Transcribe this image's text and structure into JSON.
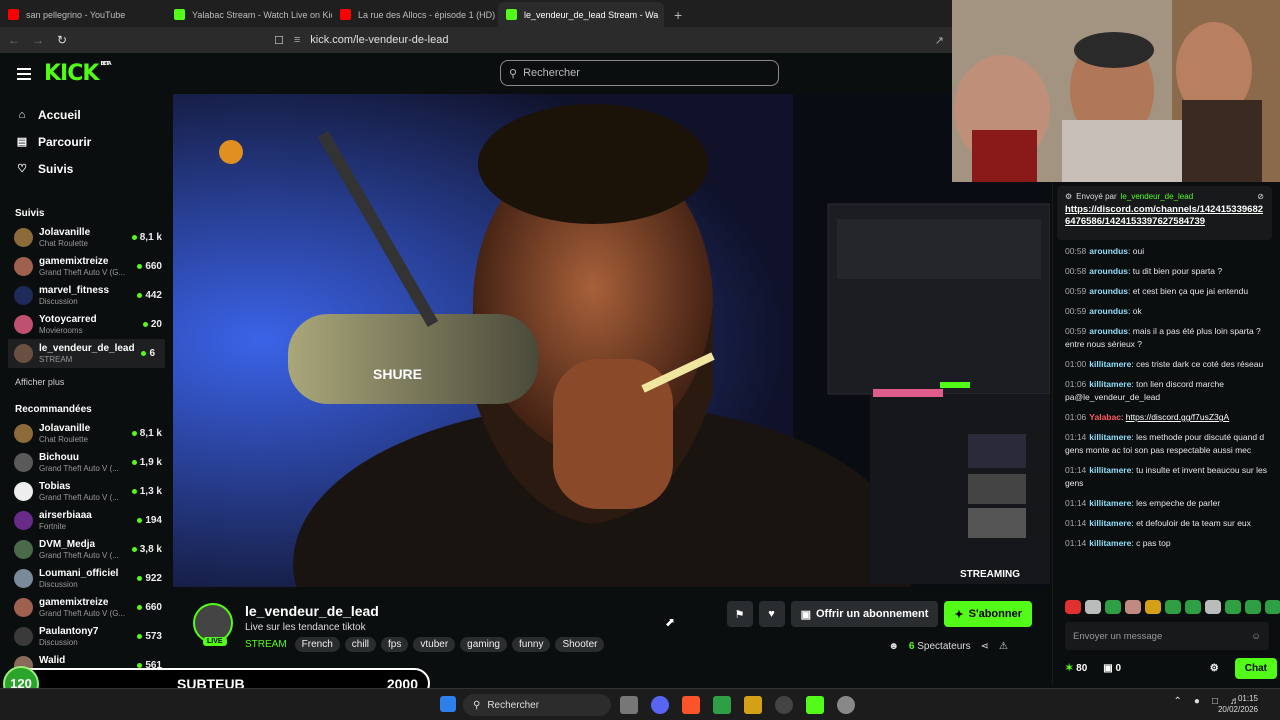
{
  "browser": {
    "tabs": [
      {
        "title": "san pellegrino - YouTube",
        "icon": "youtube-favicon",
        "color": "#ff0000",
        "active": false
      },
      {
        "title": "Yalabac Stream - Watch Live on Kick",
        "icon": "kick-favicon",
        "color": "#53fc18",
        "active": false
      },
      {
        "title": "La rue des Allocs - épisode 1 (HD) - Y",
        "icon": "youtube-favicon",
        "color": "#ff0000",
        "active": false
      },
      {
        "title": "le_vendeur_de_lead Stream - Wa",
        "icon": "kick-favicon",
        "color": "#53fc18",
        "active": true
      }
    ],
    "url": "kick.com/le-vendeur-de-lead"
  },
  "header": {
    "logo": "KICK",
    "beta": "BETA",
    "search_placeholder": "Rechercher"
  },
  "sidebar": {
    "nav": [
      {
        "label": "Accueil",
        "icon": "home-icon"
      },
      {
        "label": "Parcourir",
        "icon": "browse-icon"
      },
      {
        "label": "Suivis",
        "icon": "heart-icon"
      }
    ],
    "following_title": "Suivis",
    "following": [
      {
        "name": "Jolavanille",
        "category": "Chat Roulette",
        "viewers": "8,1 k",
        "color": "#8c6a3a"
      },
      {
        "name": "gamemixtreize",
        "category": "Grand Theft Auto V (G...",
        "viewers": "660",
        "color": "#a06050"
      },
      {
        "name": "marvel_fitness",
        "category": "Discussion",
        "viewers": "442",
        "color": "#1e2a5a"
      },
      {
        "name": "Yotoycarred",
        "category": "Movierooms",
        "viewers": "20",
        "color": "#c05070"
      },
      {
        "name": "le_vendeur_de_lead",
        "category": "STREAM",
        "viewers": "6",
        "color": "#6a5040",
        "active": true
      }
    ],
    "show_more": "Afficher plus",
    "recommended_title": "Recommandées",
    "recommended": [
      {
        "name": "Jolavanille",
        "category": "Chat Roulette",
        "viewers": "8,1 k",
        "color": "#8c6a3a"
      },
      {
        "name": "Bichouu",
        "category": "Grand Theft Auto V (...",
        "viewers": "1,9 k",
        "color": "#5a5a5a"
      },
      {
        "name": "Tobias",
        "category": "Grand Theft Auto V (...",
        "viewers": "1,3 k",
        "color": "#eeeeee"
      },
      {
        "name": "airserbiaaa",
        "category": "Fortnite",
        "viewers": "194",
        "color": "#6a2a8a"
      },
      {
        "name": "DVM_Medja",
        "category": "Grand Theft Auto V (...",
        "viewers": "3,8 k",
        "color": "#4a6a4a"
      },
      {
        "name": "Loumani_officiel",
        "category": "Discussion",
        "viewers": "922",
        "color": "#7a8a9a"
      },
      {
        "name": "gamemixtreize",
        "category": "Grand Theft Auto V (G...",
        "viewers": "660",
        "color": "#a06050"
      },
      {
        "name": "Paulantony7",
        "category": "Discussion",
        "viewers": "573",
        "color": "#3a3a3a"
      },
      {
        "name": "Walid",
        "category": "Grand Theft Auto V (G...",
        "viewers": "561",
        "color": "#8a6a5a"
      }
    ]
  },
  "video": {
    "mic_brand": "SHURE",
    "overlay_label": "STREAMING"
  },
  "channel": {
    "name": "le_vendeur_de_lead",
    "live": "LIVE",
    "title": "Live sur les tendance tiktok",
    "category": "STREAM",
    "tags": [
      "French",
      "chill",
      "fps",
      "vtuber",
      "gaming",
      "funny",
      "Shooter"
    ],
    "gift_label": "Offrir un abonnement",
    "subscribe_label": "S'abonner",
    "viewers_count": "6",
    "viewers_label": "Spectateurs"
  },
  "chat": {
    "pinned_by_label": "Envoyé par",
    "pinned_user": "le_vendeur_de_lead",
    "pinned_link": "https://discord.com/channels/1424153396826476586/1424153397627584739",
    "messages": [
      {
        "time": "00:58",
        "user": "aroundus",
        "text": "oui"
      },
      {
        "time": "00:58",
        "user": "aroundus",
        "text": "tu dit bien pour sparta ?"
      },
      {
        "time": "00:59",
        "user": "aroundus",
        "text": "et cest bien ça que jai entendu"
      },
      {
        "time": "00:59",
        "user": "aroundus",
        "text": "ok"
      },
      {
        "time": "00:59",
        "user": "aroundus",
        "text": "mais il a pas été plus loin sparta ? entre nous sérieux ?"
      },
      {
        "time": "01:00",
        "user": "killitamere",
        "text": "ces triste dark ce coté des réseau"
      },
      {
        "time": "01:06",
        "user": "killitamere",
        "text": "ton lien discord marche pa@le_vendeur_de_lead"
      },
      {
        "time": "01:06",
        "user": "Yalabac",
        "text": "https://discord.gg/f7usZ3gA",
        "red": true,
        "link": true
      },
      {
        "time": "01:14",
        "user": "killitamere",
        "text": "les methode pour discuté quand d gens monte ac toi son pas respectable aussi mec"
      },
      {
        "time": "01:14",
        "user": "killitamere",
        "text": "tu insulte et invent beaucou sur les gens"
      },
      {
        "time": "01:14",
        "user": "killitamere",
        "text": "les empeche de parler"
      },
      {
        "time": "01:14",
        "user": "killitamere",
        "text": "et defouloir de ta team sur eux"
      },
      {
        "time": "01:14",
        "user": "killitamere",
        "text": "c pas top"
      }
    ],
    "input_placeholder": "Envoyer un message",
    "points": "80",
    "drops": "0",
    "chat_button": "Chat"
  },
  "overlay": {
    "level": "120",
    "name": "SUBTEUB",
    "value": "2000"
  },
  "taskbar": {
    "search": "Rechercher",
    "time": "01:15",
    "date": "20/02/2026"
  }
}
